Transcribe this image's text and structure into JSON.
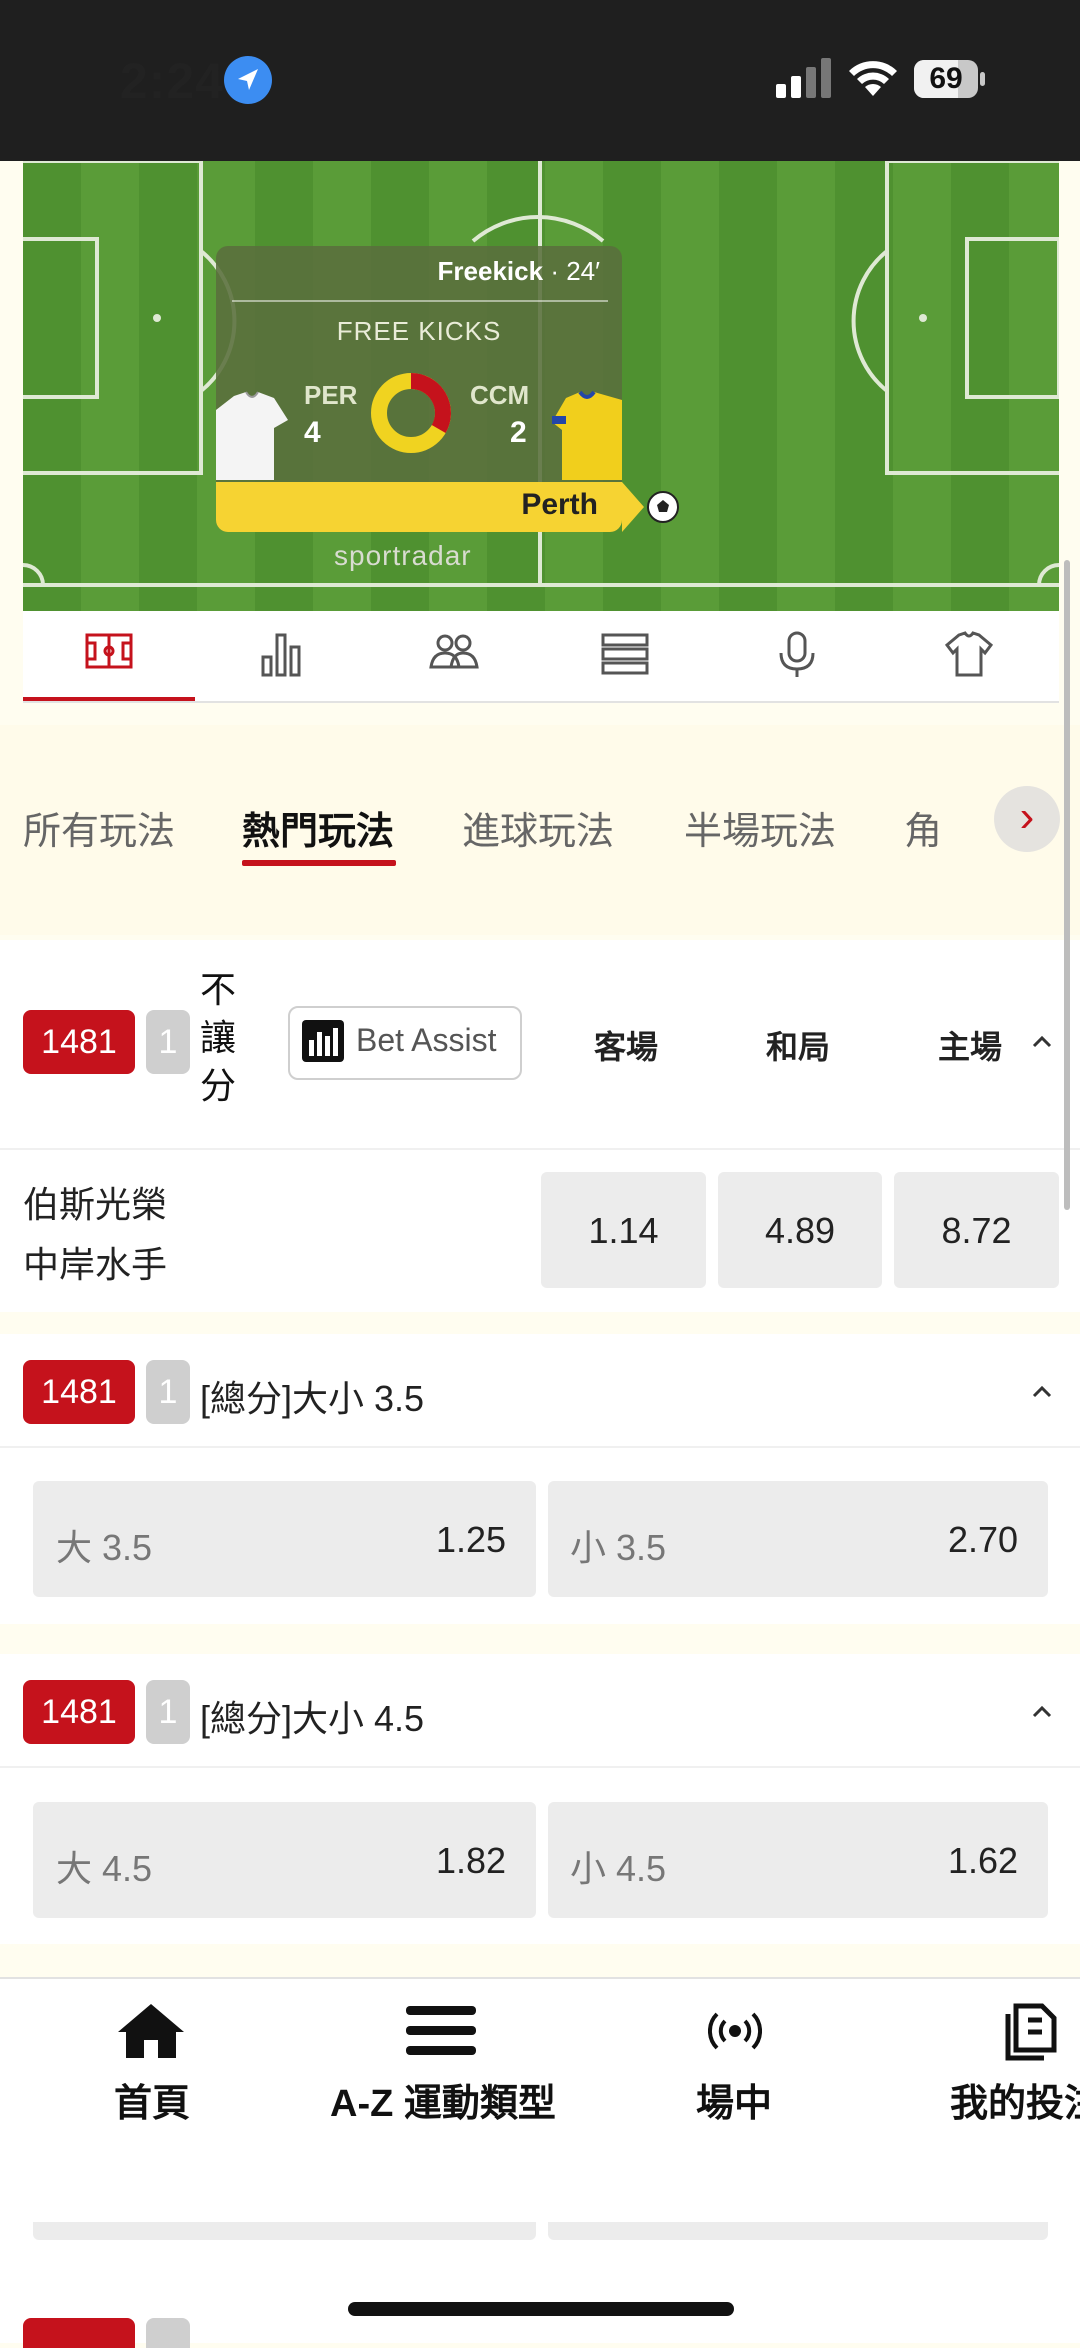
{
  "status": {
    "time": "2:24",
    "battery": "69"
  },
  "tracker": {
    "event": "Freekick",
    "minute": "· 24′",
    "stat_title": "FREE KICKS",
    "team_a": {
      "code": "PER",
      "value": "4"
    },
    "team_b": {
      "code": "CCM",
      "value": "2"
    },
    "possession_team": "Perth",
    "watermark": "sportradar"
  },
  "icon_tabs": [
    "pitch-icon",
    "stats-icon",
    "lineup-icon",
    "list-icon",
    "commentary-icon",
    "shirt-icon"
  ],
  "category_tabs": [
    "所有玩法",
    "熱門玩法",
    "進球玩法",
    "半場玩法",
    "角"
  ],
  "market1": {
    "code": "1481",
    "num": "1",
    "label_lines": [
      "不",
      "讓",
      "分"
    ],
    "bet_assist": "Bet Assist",
    "columns": [
      "客場",
      "和局",
      "主場"
    ],
    "team_home": "伯斯光榮",
    "team_away": "中岸水手",
    "odds": [
      "1.14",
      "4.89",
      "8.72"
    ]
  },
  "market2": {
    "code": "1481",
    "num": "1",
    "title": "[總分]大小 3.5",
    "over_label": "大 3.5",
    "over_odds": "1.25",
    "under_label": "小 3.5",
    "under_odds": "2.70"
  },
  "market3": {
    "code": "1481",
    "num": "1",
    "title": "[總分]大小 4.5",
    "over_label": "大 4.5",
    "over_odds": "1.82",
    "under_label": "小 4.5",
    "under_odds": "1.62"
  },
  "bottom_nav": {
    "home": "首頁",
    "sports": "A-Z 運動類型",
    "live": "場中",
    "mybets": "我的投注"
  },
  "colors": {
    "accent": "#c5121c",
    "possession": "#f6d332",
    "pitch": "#4f9130"
  }
}
